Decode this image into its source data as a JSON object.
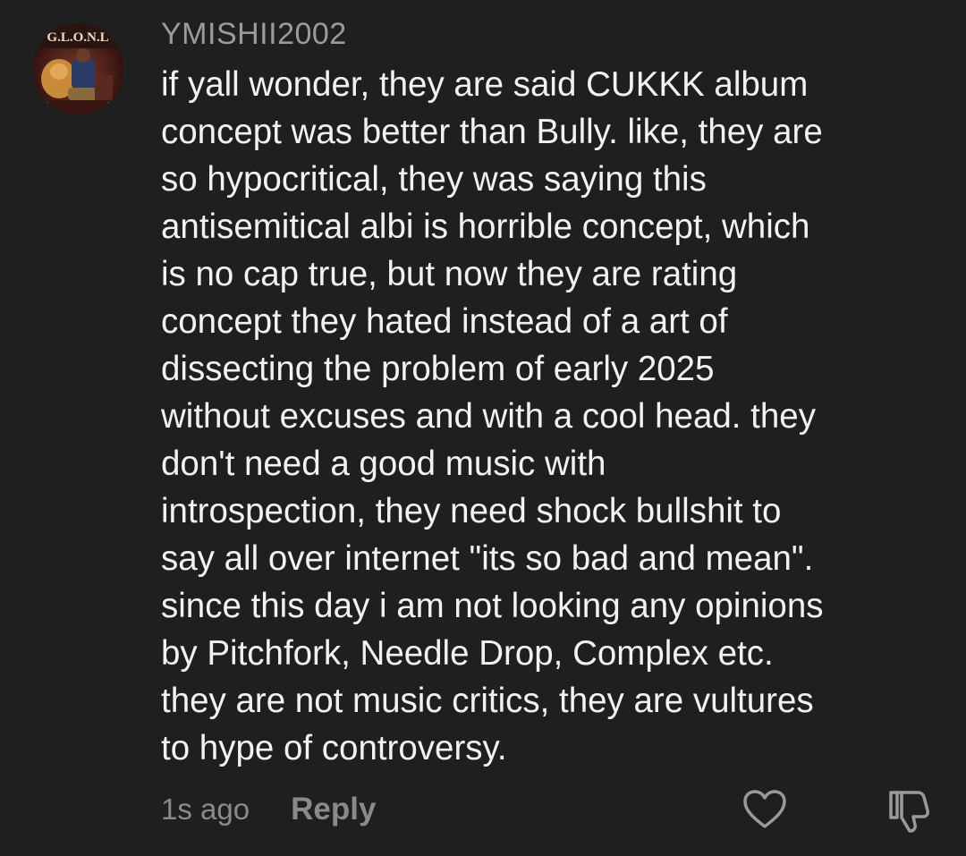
{
  "comment": {
    "username": "YMISHII2002",
    "avatar_text": "G.L.O.N.L",
    "lines": [
      "if yall wonder, they are said CUKKK album",
      "concept was better than Bully. like, they are",
      "so hypocritical, they was saying this",
      "antisemitical albi is horrible concept, which",
      "is no cap true, but now they are rating",
      "concept they hated instead of a art of",
      "dissecting the problem of early 2025",
      "without excuses and with a cool head. they",
      "don't need a good music with",
      "introspection, they need shock bullshit to",
      "say all over internet \"its so bad and mean\".",
      "since this day i am not looking any opinions",
      "by Pitchfork, Needle Drop, Complex etc.",
      "they are not music critics, they are vultures",
      "to hype of controversy."
    ],
    "timestamp": "1s ago",
    "reply_label": "Reply",
    "like_icon": "heart-outline-icon",
    "dislike_icon": "thumbs-down-outline-icon"
  },
  "colors": {
    "background": "#1f1f1f",
    "text": "#f2f2f2",
    "muted": "#8a8a8a"
  }
}
